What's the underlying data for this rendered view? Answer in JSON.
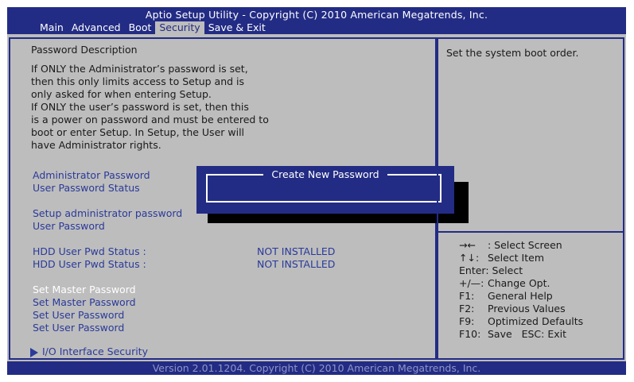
{
  "header": {
    "title": "Aptio Setup Utility - Copyright (C) 2010 American Megatrends, Inc.",
    "tabs": [
      {
        "label": "Main"
      },
      {
        "label": "Advanced"
      },
      {
        "label": "Boot"
      },
      {
        "label": "Security"
      },
      {
        "label": "Save & Exit"
      }
    ],
    "active_tab": "Security"
  },
  "left": {
    "section_title": "Password Description",
    "description": [
      "If ONLY the Administrator’s password is set,",
      "then this only limits access to Setup and is",
      "only asked for when entering Setup.",
      "If ONLY the user’s password is set, then this",
      "is a power on password and must be entered to",
      "boot or enter Setup. In Setup, the User will",
      "have Administrator rights."
    ],
    "admin_password": "Administrator Password",
    "user_password_status": "User Password Status",
    "setup_admin_password": "Setup administrator password",
    "user_password": "User Password",
    "hdd_status_1_label": "HDD User Pwd Status :",
    "hdd_status_1_value": "NOT INSTALLED",
    "hdd_status_2_label": "HDD User Pwd Status :",
    "hdd_status_2_value": "NOT INSTALLED",
    "set_master_1": "Set Master Password",
    "set_master_2": "Set Master Password",
    "set_user_1": "Set User Password",
    "set_user_2": "Set User Password",
    "io_security": "I/O Interface Security"
  },
  "popup": {
    "title": "Create New Password",
    "value": ""
  },
  "right": {
    "help_text": "Set the system boot order.",
    "keys": [
      {
        "key": "→←",
        "desc": ": Select Screen"
      },
      {
        "key": "↑↓:",
        "desc": "Select Item"
      },
      {
        "key": "Enter:",
        "desc": "Select"
      },
      {
        "key": "+/—:",
        "desc": "Change Opt."
      },
      {
        "key": "F1:",
        "desc": "General Help"
      },
      {
        "key": "F2:",
        "desc": "Previous Values"
      },
      {
        "key": "F9:",
        "desc": "Optimized Defaults"
      },
      {
        "key": "F10:",
        "desc": "Save   ESC: Exit"
      }
    ]
  },
  "footer": "Version 2.01.1204. Copyright (C) 2010 American Megatrends, Inc.",
  "colors": {
    "bar_blue": "#232c84",
    "panel_gray": "#bdbdbd",
    "item_blue": "#2a3a9a"
  }
}
